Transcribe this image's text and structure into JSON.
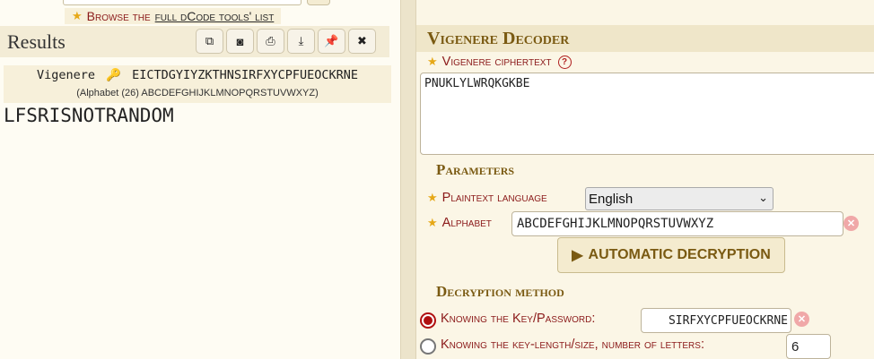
{
  "top": {
    "browse_prefix": "Browse the",
    "browse_link": "full dCode tools' list"
  },
  "results": {
    "title": "Results",
    "tools": [
      "copy-icon",
      "camera-icon",
      "print-icon",
      "download-icon",
      "pin-icon",
      "close-icon"
    ],
    "method": "Vigenere",
    "key": "EICTDGYIYZKTHNSIRFXYCPFUEOCKRNE",
    "alphabet_note": "(Alphabet (26) ABCDEFGHIJKLMNOPQRSTUVWXYZ)",
    "plaintext": "LFSRISNOTRANDOM"
  },
  "decoder": {
    "title": "Vigenere Decoder",
    "ciphertext_label": "Vigenere ciphertext",
    "ciphertext_value": "PNUKLYLWRQKGKBE",
    "parameters_heading": "Parameters",
    "language_label": "Plaintext language",
    "language_value": "English",
    "alphabet_label": "Alphabet",
    "alphabet_value": "ABCDEFGHIJKLMNOPQRSTUVWXYZ",
    "auto_button": "AUTOMATIC DECRYPTION",
    "method_heading": "Decryption method",
    "key_option_label": "Knowing the Key/Password:",
    "key_value": "SIRFXYCPFUEOCKRNE",
    "length_option_label": "Knowing the key-length/size, number of letters:",
    "length_value": "6"
  },
  "colors": {
    "label_red": "#8b1a1a",
    "heading_gold": "#7a5a12",
    "star": "#e6a817",
    "panel_bg": "#fbf6e6"
  }
}
